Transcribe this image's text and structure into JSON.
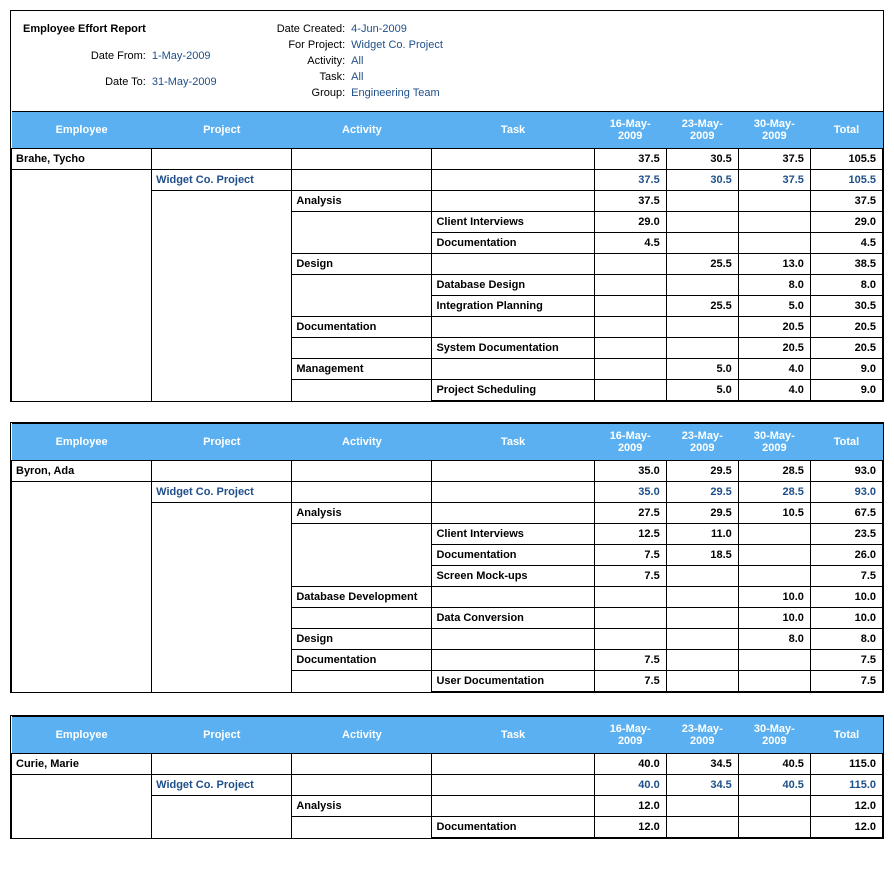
{
  "header": {
    "title": "Employee Effort Report",
    "date_from_label": "Date From:",
    "date_from": "1-May-2009",
    "date_to_label": "Date To:",
    "date_to": "31-May-2009",
    "date_created_label": "Date Created:",
    "date_created": "4-Jun-2009",
    "for_project_label": "For Project:",
    "for_project": "Widget Co. Project",
    "activity_label": "Activity:",
    "activity": "All",
    "task_label": "Task:",
    "task": "All",
    "group_label": "Group:",
    "group": "Engineering Team"
  },
  "columns": {
    "employee": "Employee",
    "project": "Project",
    "activity": "Activity",
    "task": "Task",
    "d1": "16-May-2009",
    "d2": "23-May-2009",
    "d3": "30-May-2009",
    "total": "Total"
  },
  "sections": [
    {
      "rows": [
        {
          "employee": "Brahe, Tycho",
          "project": "",
          "activity": "",
          "task": "",
          "d1": "37.5",
          "d2": "30.5",
          "d3": "37.5",
          "total": "105.5",
          "bold": true,
          "blue": false
        },
        {
          "employee": "",
          "project": "Widget Co. Project",
          "activity": "",
          "task": "",
          "d1": "37.5",
          "d2": "30.5",
          "d3": "37.5",
          "total": "105.5",
          "bold": true,
          "blue": true
        },
        {
          "employee": "",
          "project": "",
          "activity": "Analysis",
          "task": "",
          "d1": "37.5",
          "d2": "",
          "d3": "",
          "total": "37.5",
          "bold": true,
          "blue": false
        },
        {
          "employee": "",
          "project": "",
          "activity": "",
          "task": "Client Interviews",
          "d1": "29.0",
          "d2": "",
          "d3": "",
          "total": "29.0",
          "bold": true,
          "blue": false
        },
        {
          "employee": "",
          "project": "",
          "activity": "",
          "task": "Documentation",
          "d1": "4.5",
          "d2": "",
          "d3": "",
          "total": "4.5",
          "bold": true,
          "blue": false
        },
        {
          "employee": "",
          "project": "",
          "activity": "Design",
          "task": "",
          "d1": "",
          "d2": "25.5",
          "d3": "13.0",
          "total": "38.5",
          "bold": true,
          "blue": false
        },
        {
          "employee": "",
          "project": "",
          "activity": "",
          "task": "Database Design",
          "d1": "",
          "d2": "",
          "d3": "8.0",
          "total": "8.0",
          "bold": true,
          "blue": false
        },
        {
          "employee": "",
          "project": "",
          "activity": "",
          "task": "Integration Planning",
          "d1": "",
          "d2": "25.5",
          "d3": "5.0",
          "total": "30.5",
          "bold": true,
          "blue": false
        },
        {
          "employee": "",
          "project": "",
          "activity": "Documentation",
          "task": "",
          "d1": "",
          "d2": "",
          "d3": "20.5",
          "total": "20.5",
          "bold": true,
          "blue": false
        },
        {
          "employee": "",
          "project": "",
          "activity": "",
          "task": "System Documentation",
          "d1": "",
          "d2": "",
          "d3": "20.5",
          "total": "20.5",
          "bold": true,
          "blue": false
        },
        {
          "employee": "",
          "project": "",
          "activity": "Management",
          "task": "",
          "d1": "",
          "d2": "5.0",
          "d3": "4.0",
          "total": "9.0",
          "bold": true,
          "blue": false
        },
        {
          "employee": "",
          "project": "",
          "activity": "",
          "task": "Project Scheduling",
          "d1": "",
          "d2": "5.0",
          "d3": "4.0",
          "total": "9.0",
          "bold": true,
          "blue": false
        }
      ]
    },
    {
      "rows": [
        {
          "employee": "Byron, Ada",
          "project": "",
          "activity": "",
          "task": "",
          "d1": "35.0",
          "d2": "29.5",
          "d3": "28.5",
          "total": "93.0",
          "bold": true,
          "blue": false
        },
        {
          "employee": "",
          "project": "Widget Co. Project",
          "activity": "",
          "task": "",
          "d1": "35.0",
          "d2": "29.5",
          "d3": "28.5",
          "total": "93.0",
          "bold": true,
          "blue": true
        },
        {
          "employee": "",
          "project": "",
          "activity": "Analysis",
          "task": "",
          "d1": "27.5",
          "d2": "29.5",
          "d3": "10.5",
          "total": "67.5",
          "bold": true,
          "blue": false
        },
        {
          "employee": "",
          "project": "",
          "activity": "",
          "task": "Client Interviews",
          "d1": "12.5",
          "d2": "11.0",
          "d3": "",
          "total": "23.5",
          "bold": true,
          "blue": false
        },
        {
          "employee": "",
          "project": "",
          "activity": "",
          "task": "Documentation",
          "d1": "7.5",
          "d2": "18.5",
          "d3": "",
          "total": "26.0",
          "bold": true,
          "blue": false
        },
        {
          "employee": "",
          "project": "",
          "activity": "",
          "task": "Screen Mock-ups",
          "d1": "7.5",
          "d2": "",
          "d3": "",
          "total": "7.5",
          "bold": true,
          "blue": false
        },
        {
          "employee": "",
          "project": "",
          "activity": "Database Development",
          "task": "",
          "d1": "",
          "d2": "",
          "d3": "10.0",
          "total": "10.0",
          "bold": true,
          "blue": false
        },
        {
          "employee": "",
          "project": "",
          "activity": "",
          "task": "Data Conversion",
          "d1": "",
          "d2": "",
          "d3": "10.0",
          "total": "10.0",
          "bold": true,
          "blue": false
        },
        {
          "employee": "",
          "project": "",
          "activity": "Design",
          "task": "",
          "d1": "",
          "d2": "",
          "d3": "8.0",
          "total": "8.0",
          "bold": true,
          "blue": false
        },
        {
          "employee": "",
          "project": "",
          "activity": "Documentation",
          "task": "",
          "d1": "7.5",
          "d2": "",
          "d3": "",
          "total": "7.5",
          "bold": true,
          "blue": false
        },
        {
          "employee": "",
          "project": "",
          "activity": "",
          "task": "User Documentation",
          "d1": "7.5",
          "d2": "",
          "d3": "",
          "total": "7.5",
          "bold": true,
          "blue": false
        }
      ]
    },
    {
      "rows": [
        {
          "employee": "Curie, Marie",
          "project": "",
          "activity": "",
          "task": "",
          "d1": "40.0",
          "d2": "34.5",
          "d3": "40.5",
          "total": "115.0",
          "bold": true,
          "blue": false
        },
        {
          "employee": "",
          "project": "Widget Co. Project",
          "activity": "",
          "task": "",
          "d1": "40.0",
          "d2": "34.5",
          "d3": "40.5",
          "total": "115.0",
          "bold": true,
          "blue": true
        },
        {
          "employee": "",
          "project": "",
          "activity": "Analysis",
          "task": "",
          "d1": "12.0",
          "d2": "",
          "d3": "",
          "total": "12.0",
          "bold": true,
          "blue": false
        },
        {
          "employee": "",
          "project": "",
          "activity": "",
          "task": "Documentation",
          "d1": "12.0",
          "d2": "",
          "d3": "",
          "total": "12.0",
          "bold": true,
          "blue": false
        }
      ]
    }
  ]
}
